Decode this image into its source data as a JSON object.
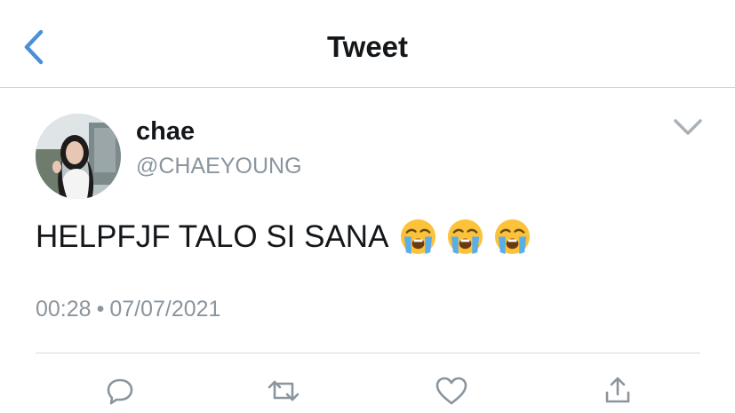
{
  "header": {
    "title": "Tweet",
    "back_icon": "chevron-left-icon"
  },
  "colors": {
    "accent": "#4a90d9",
    "text": "#14171a",
    "muted": "#8a959e",
    "divider": "#d5d9dc"
  },
  "tweet": {
    "author": {
      "display_name": "chae",
      "handle": "@CHAEYOUNG"
    },
    "text": "HELPFJF TALO SI SANA",
    "emojis": [
      "loudly-crying-face",
      "loudly-crying-face",
      "loudly-crying-face"
    ],
    "time": "00:28",
    "separator": "•",
    "date": "07/07/2021"
  },
  "actions": [
    "reply-icon",
    "retweet-icon",
    "like-icon",
    "share-icon"
  ]
}
